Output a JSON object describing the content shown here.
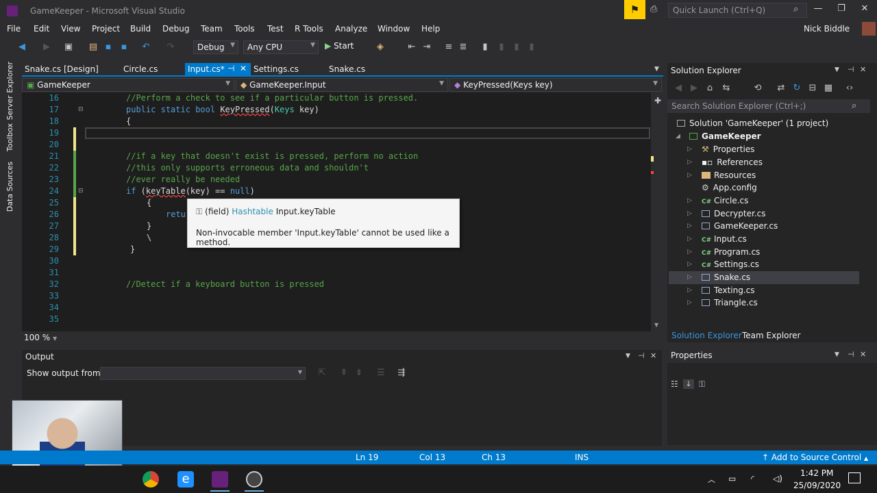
{
  "window": {
    "title": "GameKeeper - Microsoft Visual Studio",
    "quick_launch_placeholder": "Quick Launch (Ctrl+Q)",
    "user": "Nick Biddle"
  },
  "menu": [
    "File",
    "Edit",
    "View",
    "Project",
    "Build",
    "Debug",
    "Team",
    "Tools",
    "Test",
    "R Tools",
    "Analyze",
    "Window",
    "Help"
  ],
  "toolbar": {
    "config": "Debug",
    "platform": "Any CPU",
    "start_label": "Start"
  },
  "tabs": [
    {
      "label": "Snake.cs [Design]"
    },
    {
      "label": "Circle.cs"
    },
    {
      "label": "Input.cs*",
      "active": true
    },
    {
      "label": "Settings.cs"
    },
    {
      "label": "Snake.cs"
    }
  ],
  "navbar": {
    "project": "GameKeeper",
    "class": "GameKeeper.Input",
    "member": "KeyPressed(Keys key)"
  },
  "side_strip": [
    "Server Explorer",
    "Toolbox",
    "Data Sources"
  ],
  "editor": {
    "zoom": "100 %",
    "lines": [
      {
        "n": "16",
        "text": "//Perform a check to see if a particular button is pressed."
      },
      {
        "n": "17",
        "text": "public static bool KeyPressed(Keys key)"
      },
      {
        "n": "18",
        "text": "{"
      },
      {
        "n": "19",
        "text": ""
      },
      {
        "n": "20",
        "text": ""
      },
      {
        "n": "21",
        "text": "//if a key that doesn't exist is pressed, perform no action"
      },
      {
        "n": "22",
        "text": "//this only supports erroneous data and shouldn't"
      },
      {
        "n": "23",
        "text": "//ever really be needed"
      },
      {
        "n": "24",
        "text": "if (keyTable(key) == null)"
      },
      {
        "n": "25",
        "text": "{"
      },
      {
        "n": "26",
        "text": "retu"
      },
      {
        "n": "27",
        "text": "}"
      },
      {
        "n": "28",
        "text": "\\"
      },
      {
        "n": "29",
        "text": "}"
      },
      {
        "n": "30",
        "text": ""
      },
      {
        "n": "31",
        "text": ""
      },
      {
        "n": "32",
        "text": "//Detect if a keyboard button is pressed"
      },
      {
        "n": "33",
        "text": ""
      },
      {
        "n": "34",
        "text": ""
      },
      {
        "n": "35",
        "text": ""
      }
    ]
  },
  "tooltip": {
    "kind": "(field)",
    "type": "Hashtable",
    "member": "Input.keyTable",
    "message": "Non-invocable member 'Input.keyTable' cannot be used like a method."
  },
  "solution_explorer": {
    "title": "Solution Explorer",
    "search_placeholder": "Search Solution Explorer (Ctrl+;)",
    "solution": "Solution 'GameKeeper' (1 project)",
    "project": "GameKeeper",
    "items": [
      "Properties",
      "References",
      "Resources",
      "App.config",
      "Circle.cs",
      "Decrypter.cs",
      "GameKeeper.cs",
      "Input.cs",
      "Program.cs",
      "Settings.cs",
      "Snake.cs",
      "Texting.cs",
      "Triangle.cs"
    ],
    "selected": "Snake.cs",
    "bottom_tabs": [
      "Solution Explorer",
      "Team Explorer"
    ]
  },
  "properties": {
    "title": "Properties"
  },
  "output": {
    "title": "Output",
    "show_output_label": "Show output from:"
  },
  "status": {
    "line": "Ln 19",
    "col": "Col 13",
    "ch": "Ch 13",
    "mode": "INS",
    "source_control": "Add to Source Control"
  },
  "taskbar": {
    "time": "1:42 PM",
    "date": "25/09/2020"
  }
}
